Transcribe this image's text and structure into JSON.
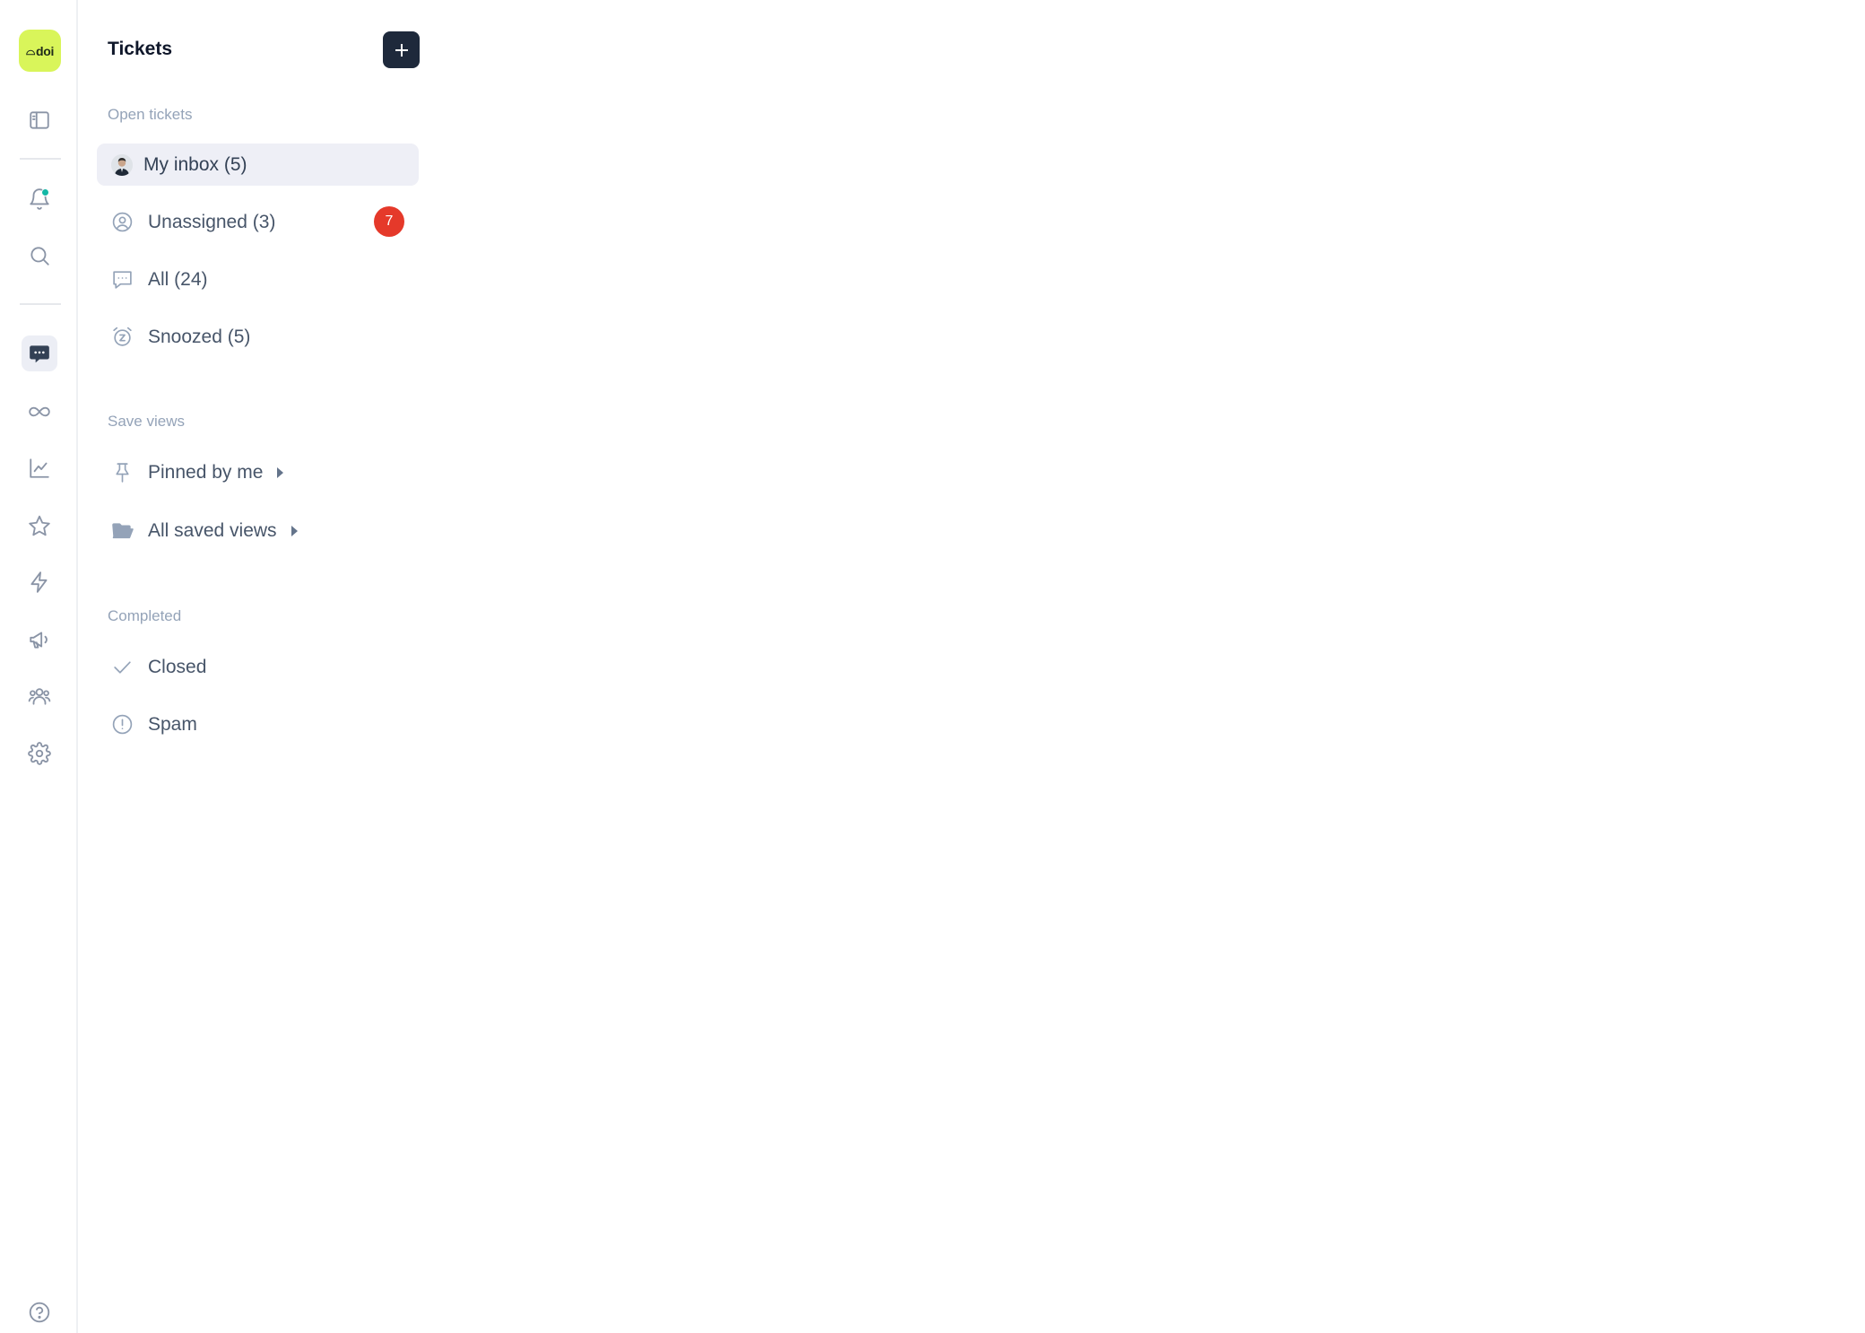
{
  "rail": {
    "logo_text": "doi",
    "items": [
      {
        "icon": "sidebar-toggle-icon"
      },
      {
        "icon": "bell-icon",
        "has_notification": true
      },
      {
        "icon": "search-icon"
      },
      {
        "icon": "chat-icon",
        "active": true
      },
      {
        "icon": "infinity-icon"
      },
      {
        "icon": "chart-line-icon"
      },
      {
        "icon": "star-icon"
      },
      {
        "icon": "bolt-icon"
      },
      {
        "icon": "megaphone-icon"
      },
      {
        "icon": "users-icon"
      },
      {
        "icon": "settings-icon"
      },
      {
        "icon": "help-icon"
      }
    ]
  },
  "panel": {
    "title": "Tickets",
    "add_button": {
      "icon": "plus-icon"
    },
    "sections": {
      "open": {
        "label": "Open tickets",
        "items": [
          {
            "label": "My inbox (5)",
            "icon": "avatar",
            "selected": true
          },
          {
            "label": "Unassigned (3)",
            "icon": "user-circle-icon",
            "badge": "7"
          },
          {
            "label": "All (24)",
            "icon": "message-square-icon"
          },
          {
            "label": "Snoozed (5)",
            "icon": "alarm-clock-icon"
          }
        ]
      },
      "views": {
        "label": "Save views",
        "items": [
          {
            "label": "Pinned by me",
            "icon": "pin-icon"
          },
          {
            "label": "All saved views",
            "icon": "folder-open-icon"
          }
        ]
      },
      "completed": {
        "label": "Completed",
        "items": [
          {
            "label": "Closed",
            "icon": "check-icon"
          },
          {
            "label": "Spam",
            "icon": "alert-circle-icon"
          }
        ]
      }
    }
  },
  "colors": {
    "logo_bg": "#d9f55a",
    "add_button_bg": "#1e293b",
    "badge_bg": "#e5392a",
    "notification_dot": "#14b8a6",
    "selected_bg": "#eeeff6"
  }
}
